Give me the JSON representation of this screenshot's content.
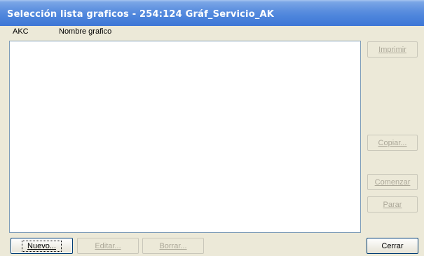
{
  "window": {
    "title": "Selección lista graficos - 254:124  Gráf_Servicio_AK"
  },
  "list": {
    "columns": [
      "AKC",
      "Nombre grafico"
    ],
    "rows": []
  },
  "buttons": {
    "imprimir": "Imprimir",
    "copiar": "Copiar...",
    "comenzar": "Comenzar",
    "parar": "Parar",
    "nuevo": "Nuevo...",
    "editar": "Editar...",
    "borrar": "Borrar...",
    "cerrar": "Cerrar"
  }
}
